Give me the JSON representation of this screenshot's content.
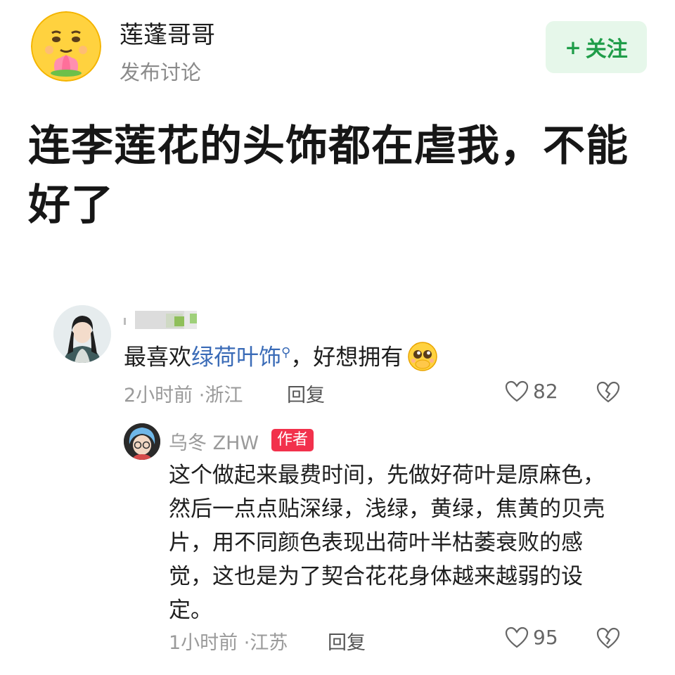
{
  "post": {
    "author_name": "莲蓬哥哥",
    "action": "发布讨论",
    "follow_label": "关注",
    "follow_plus": "+",
    "title": "连李莲花的头饰都在虐我，不能好了"
  },
  "comments": [
    {
      "body_before": "最喜欢",
      "link_text": "绿荷叶饰",
      "body_after": "，好想拥有",
      "time": "2小时前",
      "location": "浙江",
      "reply_label": "回复",
      "likes": "82"
    },
    {
      "author_name": "乌冬 ZHW",
      "badge": "作者",
      "body": "这个做起来最费时间，先做好荷叶是原麻色，然后一点点贴深绿，浅绿，黄绿，焦黄的贝壳片，用不同颜色表现出荷叶半枯萎衰败的感觉，这也是为了契合花花身体越来越弱的设定。",
      "time": "1小时前",
      "location": "江苏",
      "reply_label": "回复",
      "likes": "95"
    }
  ],
  "separator": "·",
  "colors": {
    "follow_bg": "#e6f7ea",
    "follow_text": "#1f9d49",
    "link": "#3a6bb7",
    "author_badge": "#f2314c"
  },
  "icons": [
    "emoji-avatar",
    "search-icon",
    "pleading-face-emoji",
    "heart-icon",
    "broken-heart-icon"
  ]
}
